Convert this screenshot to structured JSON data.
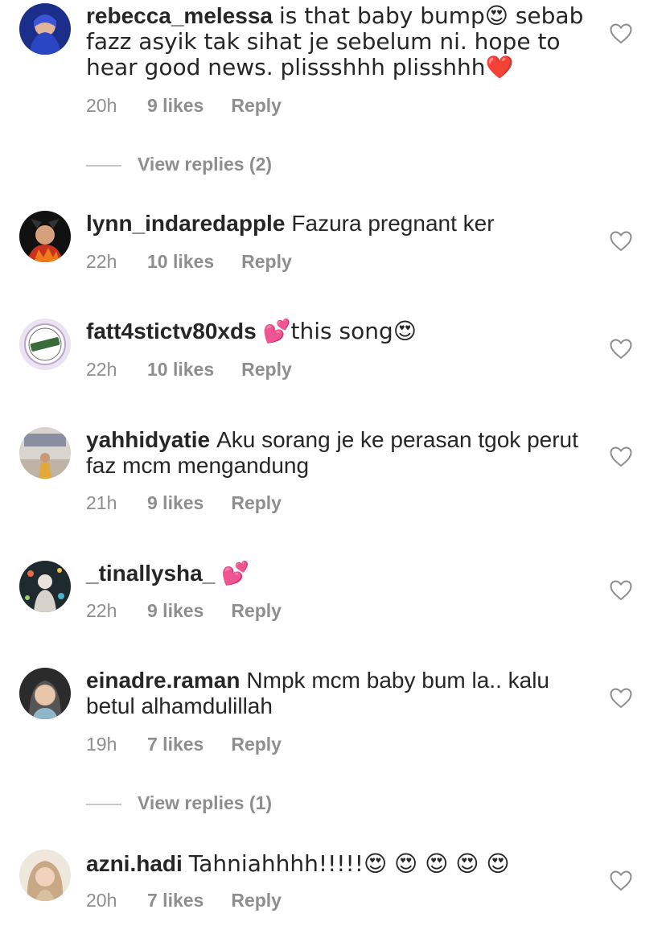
{
  "comments": [
    {
      "username": "rebecca_melessa",
      "text": "is that baby bump😍  sebab fazz asyik tak sihat je sebelum ni. hope to hear good news. plissshhh plisshhh❤️",
      "time": "20h",
      "likes": "9 likes",
      "reply": "Reply"
    },
    {
      "username": "lynn_indaredapple",
      "text": "Fazura pregnant ker",
      "time": "22h",
      "likes": "10 likes",
      "reply": "Reply"
    },
    {
      "username": "fatt4stictv80xds",
      "text": "💕this song😍",
      "time": "22h",
      "likes": "10 likes",
      "reply": "Reply"
    },
    {
      "username": "yahhidyatie",
      "text": "Aku sorang je ke perasan tgok perut faz mcm mengandung",
      "time": "21h",
      "likes": "9 likes",
      "reply": "Reply"
    },
    {
      "username": "_tinallysha_",
      "text": "💕",
      "time": "22h",
      "likes": "9 likes",
      "reply": "Reply"
    },
    {
      "username": "einadre.raman",
      "text": "Nmpk mcm baby bum la.. kalu betul alhamdulillah",
      "time": "19h",
      "likes": "7 likes",
      "reply": "Reply"
    },
    {
      "username": "azni.hadi",
      "text": "Tahniahhhh!!!!!😍 😍 😍 😍 😍",
      "time": "20h",
      "likes": "7 likes",
      "reply": "Reply"
    }
  ],
  "view_replies": [
    {
      "label": "View replies (2)"
    },
    {
      "label": "View replies (1)"
    }
  ],
  "colors": {
    "text": "#262626",
    "meta": "#8e8e8e",
    "divider": "#c7c7c7"
  }
}
